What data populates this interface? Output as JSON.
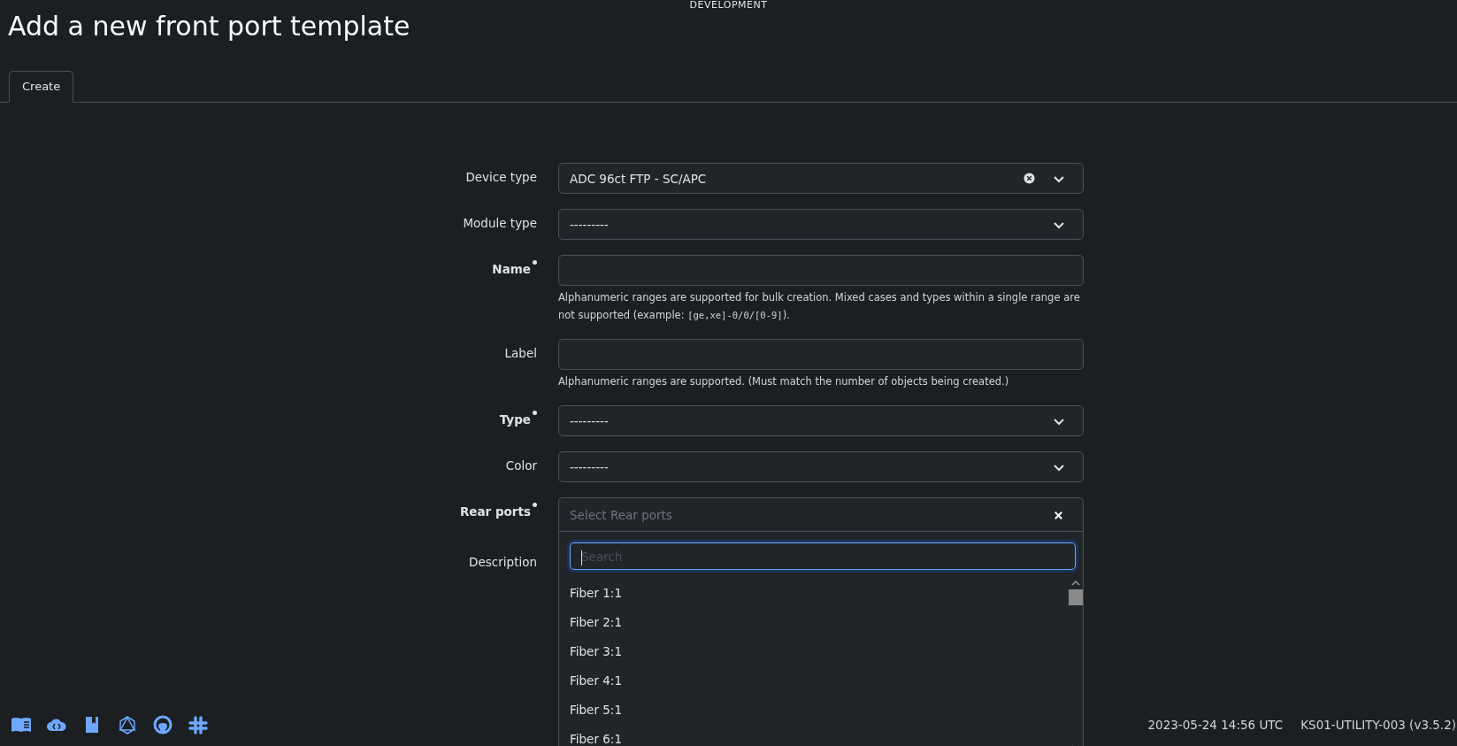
{
  "header": {
    "environment": "DEVELOPMENT",
    "title": "Add a new front port template"
  },
  "tabs": [
    {
      "label": "Create",
      "selected": true
    }
  ],
  "form": {
    "fields": [
      {
        "label": "Device type",
        "kind": "select",
        "required": false,
        "value": "ADC 96ct FTP - SC/APC",
        "clearable": true
      },
      {
        "label": "Module type",
        "kind": "select",
        "required": false,
        "value": "---------",
        "clearable": false
      },
      {
        "label": "Name",
        "kind": "text",
        "required": true,
        "help": [
          {
            "kind": "text",
            "text": "Alphanumeric ranges are supported for bulk creation. Mixed cases and types within a single range are not supported (example: "
          },
          {
            "kind": "code",
            "text": "[ge,xe]-0/0/[0-9]"
          },
          {
            "kind": "text",
            "text": ")."
          }
        ]
      },
      {
        "label": "Label",
        "kind": "text",
        "required": false,
        "help": [
          {
            "kind": "text",
            "text": "Alphanumeric ranges are supported. (Must match the number of objects being created.)"
          }
        ]
      },
      {
        "label": "Type",
        "kind": "select",
        "required": true,
        "value": "---------",
        "clearable": false
      },
      {
        "label": "Color",
        "kind": "select",
        "required": false,
        "value": "---------",
        "clearable": false
      },
      {
        "label": "Rear ports",
        "kind": "multiselect",
        "required": true,
        "placeholder": "Select Rear ports",
        "expanded": true,
        "dropdown": {
          "search_placeholder": "Search",
          "search_focused": true,
          "options": [
            "Fiber 1:1",
            "Fiber 2:1",
            "Fiber 3:1",
            "Fiber 4:1",
            "Fiber 5:1",
            "Fiber 6:1"
          ]
        }
      },
      {
        "label": "Description",
        "kind": "hidden_text",
        "required": false
      }
    ]
  },
  "footer": {
    "timestamp": "2023-05-24 14:56 UTC",
    "instance": "KS01-UTILITY-003 (v3.5.2)"
  }
}
